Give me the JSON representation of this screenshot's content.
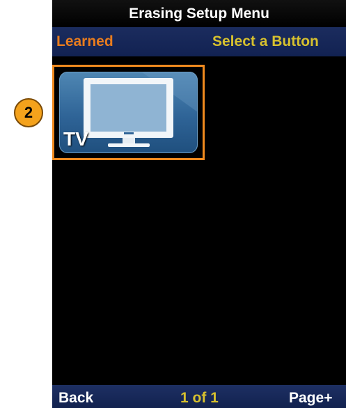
{
  "header": {
    "title": "Erasing Setup Menu"
  },
  "subheader": {
    "left_label": "Learned",
    "right_label": "Select a Button"
  },
  "grid": {
    "items": [
      {
        "label": "TV",
        "icon": "tv-icon"
      }
    ]
  },
  "footer": {
    "back_label": "Back",
    "page_indicator": "1 of 1",
    "next_label": "Page+"
  },
  "callout": {
    "number": "2",
    "color": "#f4a21c"
  },
  "colors": {
    "highlight": "#f08a1e",
    "accent_yellow": "#d7c12e",
    "accent_orange": "#e87c1e",
    "bar_blue": "#1b2c5e"
  }
}
